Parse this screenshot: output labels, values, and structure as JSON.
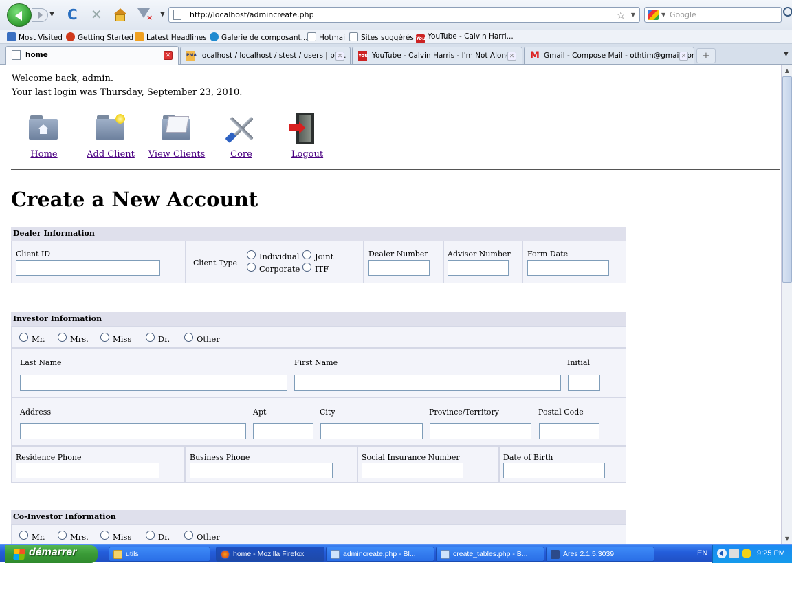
{
  "browser": {
    "url": "http://localhost/admincreate.php",
    "search_placeholder": "Google",
    "bookmarks": [
      "Most Visited",
      "Getting Started",
      "Latest Headlines",
      "Galerie de composant...",
      "Hotmail",
      "Sites suggérés",
      "YouTube - Calvin Harri..."
    ],
    "tabs": [
      "home",
      "localhost / localhost / stest / users | ph...",
      "YouTube - Calvin Harris - I'm Not Alone",
      "Gmail - Compose Mail - othtim@gmail.com"
    ],
    "new_tab": "+"
  },
  "page": {
    "welcome": "Welcome back, admin.",
    "last_login": "Your last login was Thursday, September 23, 2010.",
    "nav": [
      "Home",
      "Add Client",
      "View Clients",
      "Core",
      "Logout"
    ],
    "title": "Create a New Account",
    "dealer": {
      "heading": "Dealer Information",
      "client_id": "Client ID",
      "client_type": "Client Type",
      "type_options": [
        "Individual",
        "Joint",
        "Corporate",
        "ITF"
      ],
      "dealer_number": "Dealer Number",
      "advisor_number": "Advisor Number",
      "form_date": "Form Date"
    },
    "investor": {
      "heading": "Investor Information",
      "titles": [
        "Mr.",
        "Mrs.",
        "Miss",
        "Dr.",
        "Other"
      ],
      "last_name": "Last Name",
      "first_name": "First Name",
      "initial": "Initial",
      "address": "Address",
      "apt": "Apt",
      "city": "City",
      "province": "Province/Territory",
      "postal_code": "Postal Code",
      "residence_phone": "Residence Phone",
      "business_phone": "Business Phone",
      "sin": "Social Insurance Number",
      "dob": "Date of Birth"
    },
    "coinvestor": {
      "heading": "Co-Investor Information",
      "titles": [
        "Mr.",
        "Mrs.",
        "Miss",
        "Dr.",
        "Other"
      ]
    }
  },
  "taskbar": {
    "start": "démarrer",
    "tasks": [
      "utils",
      "home - Mozilla Firefox",
      "admincreate.php - Bl...",
      "create_tables.php - B...",
      "Ares 2.1.5.3039"
    ],
    "lang": "EN",
    "time": "9:25 PM"
  }
}
